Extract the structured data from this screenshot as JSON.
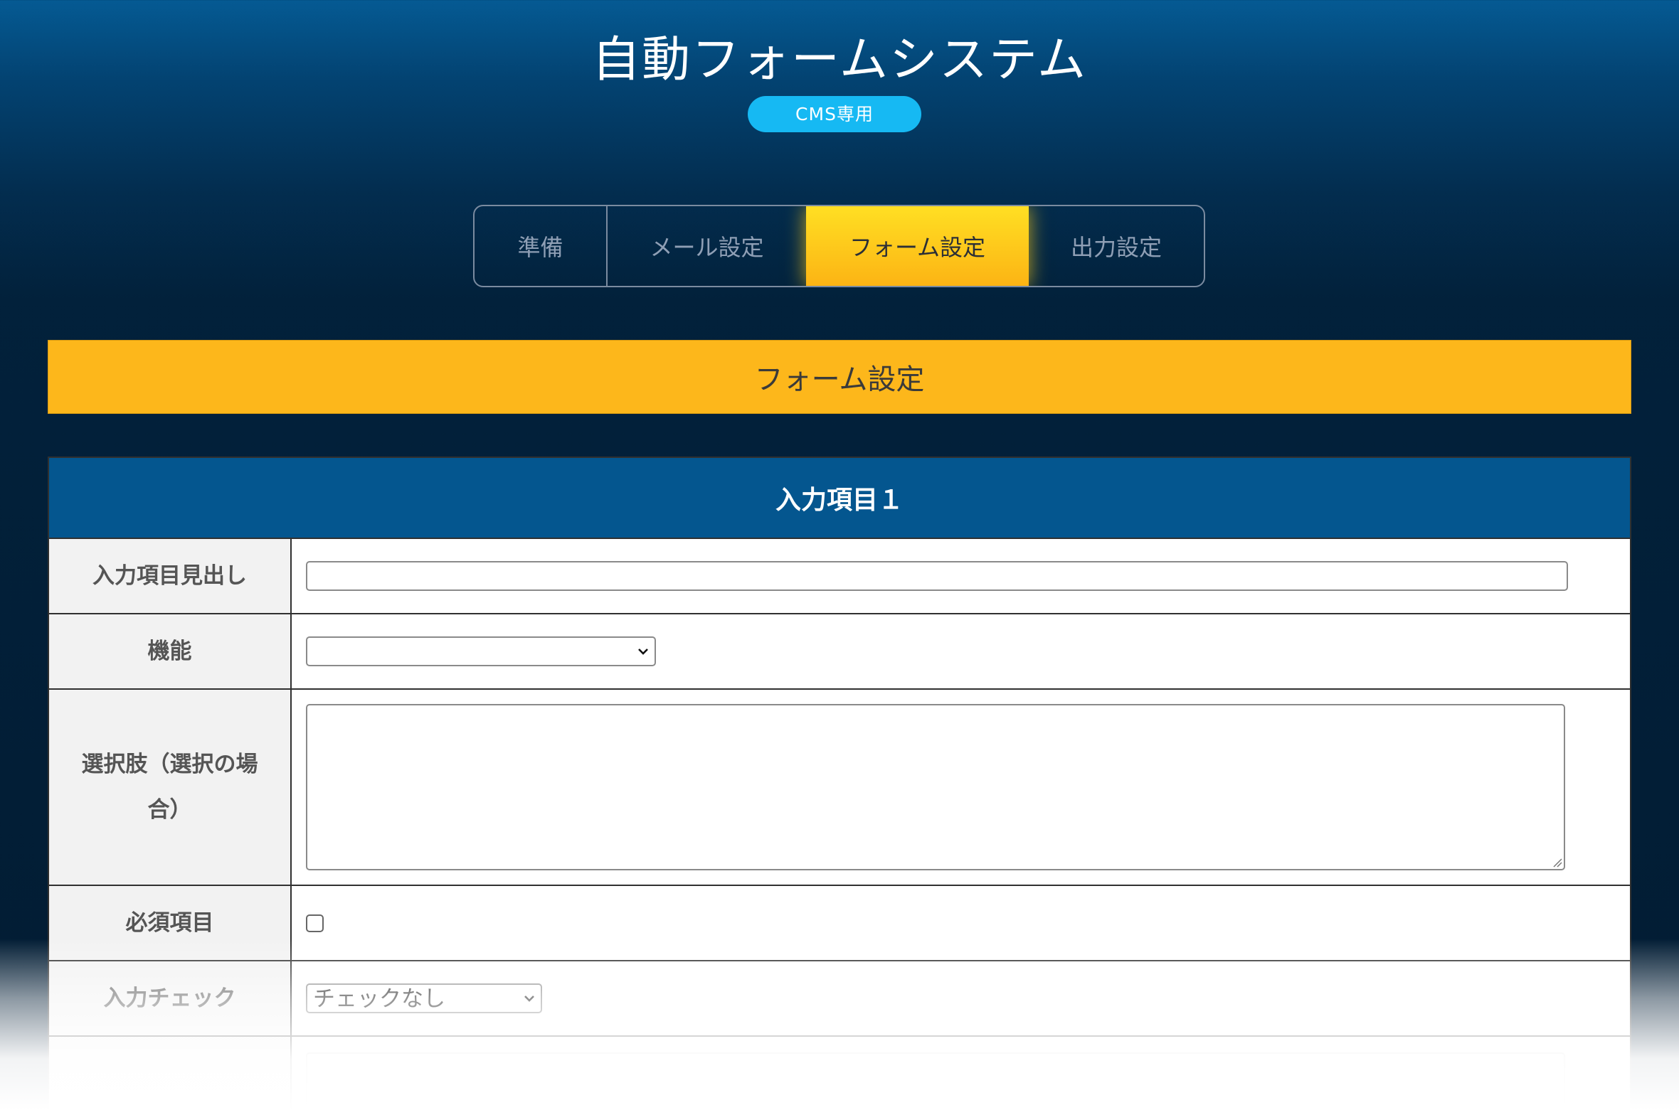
{
  "header": {
    "title": "自動フォームシステム",
    "badge": "CMS専用"
  },
  "tabs": [
    {
      "label": "準備",
      "active": false
    },
    {
      "label": "メール設定",
      "active": false
    },
    {
      "label": "フォーム設定",
      "active": true
    },
    {
      "label": "出力設定",
      "active": false
    }
  ],
  "section": {
    "title": "フォーム設定"
  },
  "form_card": {
    "title": "入力項目１",
    "rows": [
      {
        "label": "入力項目見出し",
        "type": "text",
        "value": ""
      },
      {
        "label": "機能",
        "type": "select",
        "value": ""
      },
      {
        "label_line1": "選択肢（選択の場",
        "label_line2": "合）",
        "type": "textarea",
        "value": ""
      },
      {
        "label": "必須項目",
        "type": "checkbox",
        "checked": false
      },
      {
        "label": "入力チェック",
        "type": "select",
        "value": "チェックなし"
      }
    ]
  },
  "colors": {
    "accent": "#fdb71b",
    "header_blue": "#04568f",
    "badge": "#16b9f3"
  }
}
